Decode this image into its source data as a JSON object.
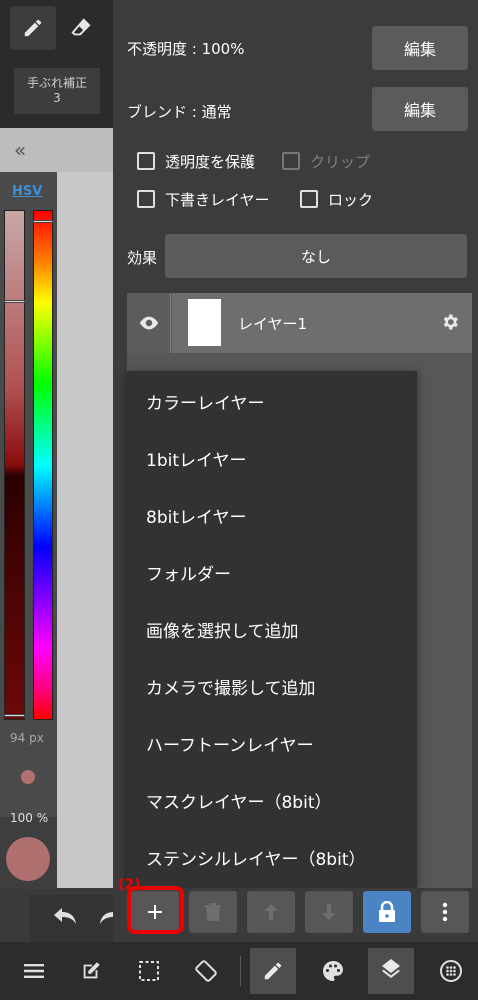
{
  "left": {
    "stabilizer": {
      "label": "手ぶれ補正",
      "value": "3"
    },
    "color_mode": "HSV",
    "brush_size": "94 px",
    "opacity": "100 %",
    "current_color": "#b07070"
  },
  "panel": {
    "opacity_label": "不透明度 : 100%",
    "blend_label": "ブレンド : 通常",
    "edit_label": "編集",
    "checkboxes": {
      "protect_alpha": "透明度を保護",
      "clip": "クリップ",
      "draft": "下書きレイヤー",
      "lock": "ロック"
    },
    "effect_label": "効果",
    "effect_value": "なし",
    "layer_name": "レイヤー1"
  },
  "menu": {
    "items": [
      "カラーレイヤー",
      "1bitレイヤー",
      "8bitレイヤー",
      "フォルダー",
      "画像を選択して追加",
      "カメラで撮影して追加",
      "ハーフトーンレイヤー",
      "マスクレイヤー（8bit）",
      "ステンシルレイヤー（8bit）"
    ]
  },
  "annotation": "(2)",
  "colors": {
    "accent_blue": "#4a84c4",
    "highlight_red": "#ee0000"
  }
}
